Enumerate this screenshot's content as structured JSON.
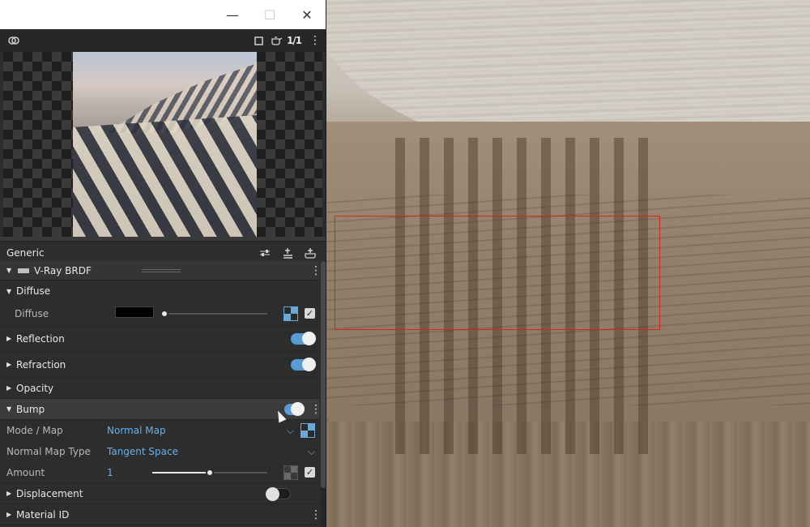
{
  "window": {
    "minimize": "—",
    "maximize": "☐",
    "close": "✕"
  },
  "preview_toolbar": {
    "ratio": "1/1"
  },
  "generic": {
    "title": "Generic"
  },
  "brdf": {
    "title": "V-Ray BRDF"
  },
  "diffuse_section": {
    "title": "Diffuse",
    "param_label": "Diffuse",
    "color": "#000000",
    "slider_value": 0.0,
    "enabled": true
  },
  "reflection": {
    "title": "Reflection",
    "enabled": true
  },
  "refraction": {
    "title": "Refraction",
    "enabled": true
  },
  "opacity": {
    "title": "Opacity"
  },
  "bump": {
    "title": "Bump",
    "enabled": true,
    "mode_label": "Mode / Map",
    "mode_value": "Normal Map",
    "normal_type_label": "Normal Map Type",
    "normal_type_value": "Tangent Space",
    "amount_label": "Amount",
    "amount_value": "1",
    "amount_slider": 0.5
  },
  "displacement": {
    "title": "Displacement",
    "enabled": false
  },
  "material_id": {
    "title": "Material ID"
  },
  "colors": {
    "accent": "#5a9bd5",
    "link": "#6ab0e6",
    "selection": "#e0201b"
  },
  "icons": [
    "material-link-icon",
    "frame-icon",
    "teapot-icon",
    "ratio-icon",
    "kebab-icon",
    "sliders-icon",
    "add-layer-icon",
    "add-material-icon"
  ]
}
